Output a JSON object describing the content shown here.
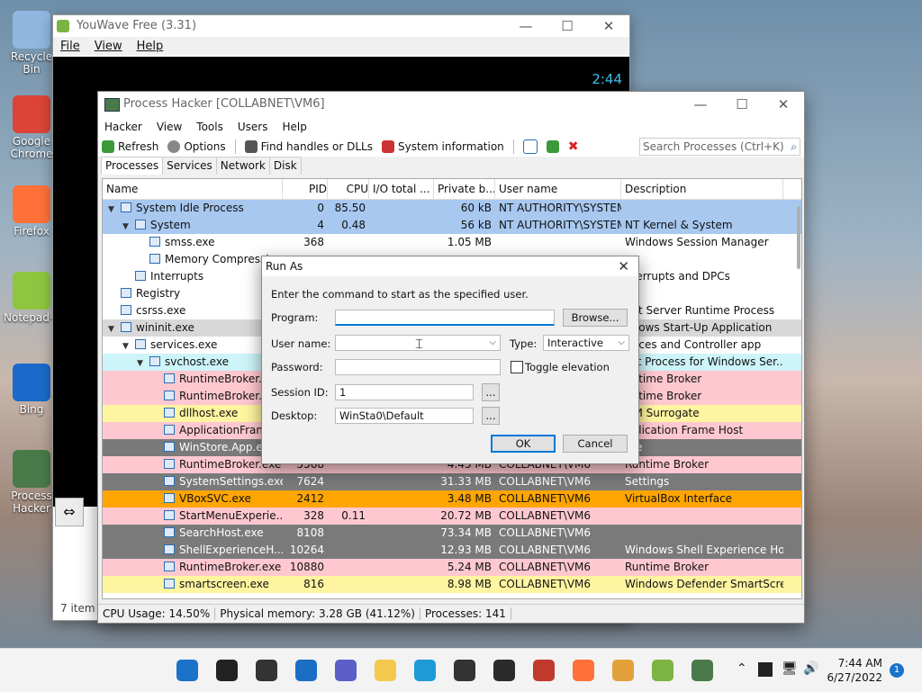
{
  "desktop": {
    "icons": [
      {
        "label": "Recycle Bin",
        "color": "#8fb7e0"
      },
      {
        "label": "Google Chrome",
        "color": "#db4437"
      },
      {
        "label": "Firefox",
        "color": "#ff7139"
      },
      {
        "label": "Notepad++",
        "color": "#8ec63f"
      },
      {
        "label": "Bing",
        "color": "#1b6ac9"
      },
      {
        "label": "Process Hacker",
        "color": "#4a7a4a"
      }
    ],
    "items_count": "7 item"
  },
  "youwave": {
    "title": "YouWave Free (3.31)",
    "menu": [
      "File",
      "View",
      "Help"
    ],
    "time": "2:44"
  },
  "ph": {
    "title": "Process Hacker [COLLABNET\\VM6]",
    "menu": [
      "Hacker",
      "View",
      "Tools",
      "Users",
      "Help"
    ],
    "toolbar": {
      "refresh": "Refresh",
      "options": "Options",
      "find_handles": "Find handles or DLLs",
      "sysinfo": "System information",
      "search_placeholder": "Search Processes (Ctrl+K)"
    },
    "tabs": [
      "Processes",
      "Services",
      "Network",
      "Disk"
    ],
    "columns": [
      "Name",
      "PID",
      "CPU",
      "I/O total ...",
      "Private b...",
      "User name",
      "Description"
    ],
    "rows": [
      {
        "indent": 0,
        "tw": "v",
        "name": "System Idle Process",
        "pid": "0",
        "cpu": "85.50",
        "io": "",
        "priv": "60 kB",
        "user": "NT AUTHORITY\\SYSTEM",
        "desc": "",
        "bg": "#a8c8f0"
      },
      {
        "indent": 1,
        "tw": "v",
        "name": "System",
        "pid": "4",
        "cpu": "0.48",
        "io": "",
        "priv": "56 kB",
        "user": "NT AUTHORITY\\SYSTEM",
        "desc": "NT Kernel & System",
        "bg": "#a8c8f0"
      },
      {
        "indent": 2,
        "tw": "",
        "name": "smss.exe",
        "pid": "368",
        "cpu": "",
        "io": "",
        "priv": "1.05 MB",
        "user": "",
        "desc": "Windows Session Manager",
        "bg": "#ffffff"
      },
      {
        "indent": 2,
        "tw": "",
        "name": "Memory Compressi",
        "pid": "",
        "cpu": "",
        "io": "",
        "priv": "",
        "user": "",
        "desc": "",
        "bg": "#ffffff"
      },
      {
        "indent": 1,
        "tw": "",
        "name": "Interrupts",
        "pid": "",
        "cpu": "",
        "io": "",
        "priv": "",
        "user": "",
        "desc": "nterrupts and DPCs",
        "bg": "#ffffff"
      },
      {
        "indent": 0,
        "tw": "",
        "name": "Registry",
        "pid": "",
        "cpu": "",
        "io": "",
        "priv": "",
        "user": "",
        "desc": "",
        "bg": "#ffffff"
      },
      {
        "indent": 0,
        "tw": "",
        "name": "csrss.exe",
        "pid": "",
        "cpu": "",
        "io": "",
        "priv": "",
        "user": "",
        "desc": "ent Server Runtime Process",
        "bg": "#ffffff"
      },
      {
        "indent": 0,
        "tw": "v",
        "name": "wininit.exe",
        "pid": "",
        "cpu": "",
        "io": "",
        "priv": "",
        "user": "",
        "desc": "ndows Start-Up Application",
        "bg": "#d8d8d8"
      },
      {
        "indent": 1,
        "tw": "v",
        "name": "services.exe",
        "pid": "",
        "cpu": "",
        "io": "",
        "priv": "",
        "user": "",
        "desc": "rvices and Controller app",
        "bg": "#ffffff"
      },
      {
        "indent": 2,
        "tw": "v",
        "name": "svchost.exe",
        "pid": "",
        "cpu": "",
        "io": "",
        "priv": "",
        "user": "",
        "desc": "ost Process for Windows Ser...",
        "bg": "#cdf4f8"
      },
      {
        "indent": 3,
        "tw": "",
        "name": "RuntimeBroker.e",
        "pid": "",
        "cpu": "",
        "io": "",
        "priv": "",
        "user": "",
        "desc": "untime Broker",
        "bg": "#ffc8d0"
      },
      {
        "indent": 3,
        "tw": "",
        "name": "RuntimeBroker.e",
        "pid": "",
        "cpu": "",
        "io": "",
        "priv": "",
        "user": "",
        "desc": "untime Broker",
        "bg": "#ffc8d0"
      },
      {
        "indent": 3,
        "tw": "",
        "name": "dllhost.exe",
        "pid": "",
        "cpu": "",
        "io": "",
        "priv": "",
        "user": "",
        "desc": "OM Surrogate",
        "bg": "#fff4a0"
      },
      {
        "indent": 3,
        "tw": "",
        "name": "ApplicationFram",
        "pid": "",
        "cpu": "",
        "io": "",
        "priv": "",
        "user": "",
        "desc": "pplication Frame Host",
        "bg": "#ffc8d0"
      },
      {
        "indent": 3,
        "tw": "",
        "name": "WinStore.App.ex",
        "pid": "",
        "cpu": "",
        "io": "",
        "priv": "",
        "user": "",
        "desc": "ore",
        "bg": "#7a7a7a"
      },
      {
        "indent": 3,
        "tw": "",
        "name": "RuntimeBroker.exe",
        "pid": "5568",
        "cpu": "",
        "io": "",
        "priv": "4.45 MB",
        "user": "COLLABNET\\VM6",
        "desc": "Runtime Broker",
        "bg": "#ffc8d0"
      },
      {
        "indent": 3,
        "tw": "",
        "name": "SystemSettings.exe",
        "pid": "7624",
        "cpu": "",
        "io": "",
        "priv": "31.33 MB",
        "user": "COLLABNET\\VM6",
        "desc": "Settings",
        "bg": "#7a7a7a"
      },
      {
        "indent": 3,
        "tw": "",
        "name": "VBoxSVC.exe",
        "pid": "2412",
        "cpu": "",
        "io": "",
        "priv": "3.48 MB",
        "user": "COLLABNET\\VM6",
        "desc": "VirtualBox Interface",
        "bg": "#ffa500"
      },
      {
        "indent": 3,
        "tw": "",
        "name": "StartMenuExperie...",
        "pid": "328",
        "cpu": "0.11",
        "io": "",
        "priv": "20.72 MB",
        "user": "COLLABNET\\VM6",
        "desc": "",
        "bg": "#ffc8d0"
      },
      {
        "indent": 3,
        "tw": "",
        "name": "SearchHost.exe",
        "pid": "8108",
        "cpu": "",
        "io": "",
        "priv": "73.34 MB",
        "user": "COLLABNET\\VM6",
        "desc": "",
        "bg": "#7a7a7a"
      },
      {
        "indent": 3,
        "tw": "",
        "name": "ShellExperienceH...",
        "pid": "10264",
        "cpu": "",
        "io": "",
        "priv": "12.93 MB",
        "user": "COLLABNET\\VM6",
        "desc": "Windows Shell Experience Host",
        "bg": "#7a7a7a"
      },
      {
        "indent": 3,
        "tw": "",
        "name": "RuntimeBroker.exe",
        "pid": "10880",
        "cpu": "",
        "io": "",
        "priv": "5.24 MB",
        "user": "COLLABNET\\VM6",
        "desc": "Runtime Broker",
        "bg": "#ffc8d0"
      },
      {
        "indent": 3,
        "tw": "",
        "name": "smartscreen.exe",
        "pid": "816",
        "cpu": "",
        "io": "",
        "priv": "8.98 MB",
        "user": "COLLABNET\\VM6",
        "desc": "Windows Defender SmartScre...",
        "bg": "#fff4a0"
      }
    ],
    "status": {
      "cpu": "CPU Usage: 14.50%",
      "mem": "Physical memory: 3.28 GB (41.12%)",
      "procs": "Processes: 141"
    }
  },
  "dialog": {
    "title": "Run As",
    "instruction": "Enter the command to start as the specified user.",
    "program_label": "Program:",
    "program_value": "",
    "browse": "Browse...",
    "username_label": "User name:",
    "username_value": "",
    "type_label": "Type:",
    "type_value": "Interactive",
    "password_label": "Password:",
    "toggle_elevation": "Toggle elevation",
    "session_label": "Session ID:",
    "session_value": "1",
    "desktop_label": "Desktop:",
    "desktop_value": "WinSta0\\Default",
    "ellipsis": "...",
    "ok": "OK",
    "cancel": "Cancel"
  },
  "taskbar": {
    "time": "7:44 AM",
    "date": "6/27/2022",
    "notifications": "1",
    "apps": [
      {
        "name": "start-icon",
        "color": "#1a73c8"
      },
      {
        "name": "search-icon",
        "color": "#222222"
      },
      {
        "name": "task-view-icon",
        "color": "#333333"
      },
      {
        "name": "widgets-icon",
        "color": "#1a6fc4"
      },
      {
        "name": "chat-icon",
        "color": "#5b5fc7"
      },
      {
        "name": "file-explorer-icon",
        "color": "#f2c94c"
      },
      {
        "name": "edge-icon",
        "color": "#1d9bd7"
      },
      {
        "name": "store-icon",
        "color": "#333333"
      },
      {
        "name": "terminal-icon",
        "color": "#2b2b2b"
      },
      {
        "name": "filezilla-icon",
        "color": "#c0392b"
      },
      {
        "name": "firefox-icon",
        "color": "#ff7139"
      },
      {
        "name": "colorful-icon",
        "color": "#e2a13a"
      },
      {
        "name": "android-icon",
        "color": "#7cb342"
      },
      {
        "name": "process-hacker-icon",
        "color": "#4a7a4a"
      }
    ]
  }
}
